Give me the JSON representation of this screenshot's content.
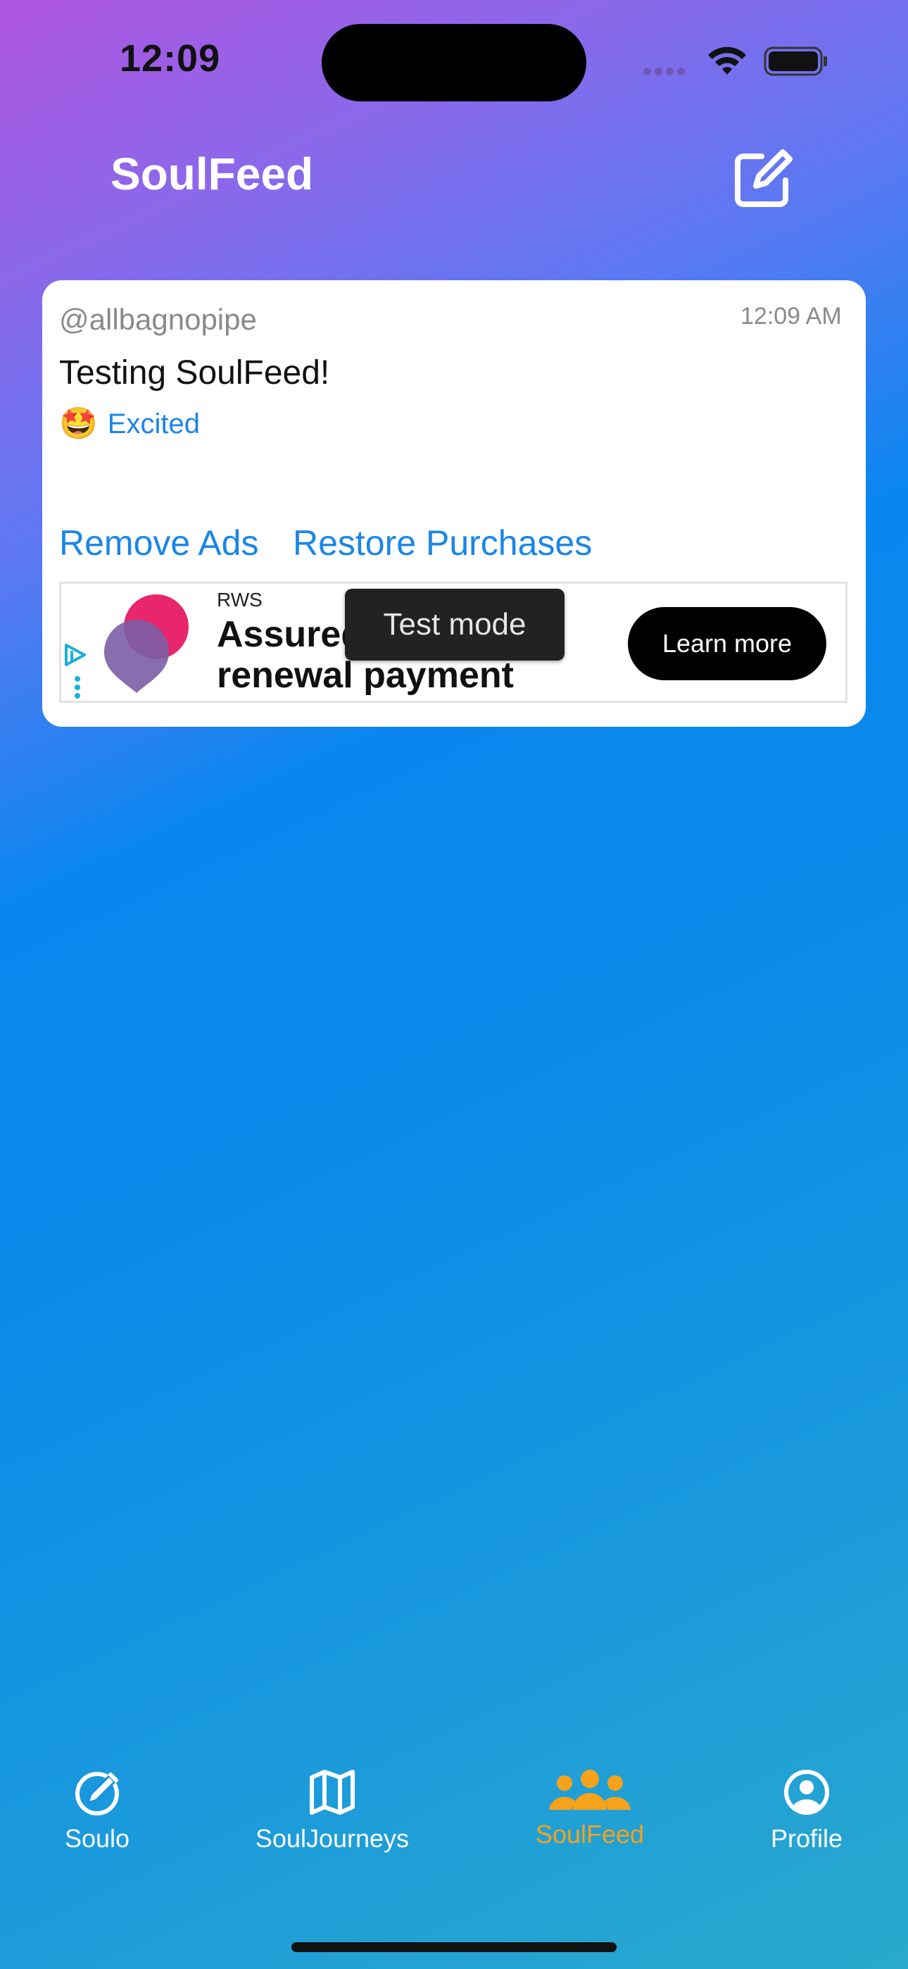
{
  "status_bar": {
    "time": "12:09"
  },
  "header": {
    "title": "SoulFeed",
    "compose_icon": "compose-icon"
  },
  "post": {
    "username": "@allbagnopipe",
    "time": "12:09 AM",
    "text": "Testing SoulFeed!",
    "mood_emoji": "🤩",
    "mood_label": "Excited"
  },
  "actions": {
    "remove_ads": "Remove Ads",
    "restore_purchases": "Restore Purchases"
  },
  "ad": {
    "advertiser": "RWS",
    "headline_line1": "Assured",
    "headline_line2": "renewal payment",
    "cta": "Learn more",
    "test_mode_label": "Test mode"
  },
  "tab_bar": {
    "items": [
      {
        "label": "Soulo",
        "icon": "compass-pen-icon"
      },
      {
        "label": "SoulJourneys",
        "icon": "map-icon"
      },
      {
        "label": "SoulFeed",
        "icon": "people-icon",
        "active": true
      },
      {
        "label": "Profile",
        "icon": "person-circle-icon"
      }
    ],
    "active_color": "#F6A21A"
  },
  "colors": {
    "link": "#1A86E8",
    "card_bg": "#FFFFFF"
  }
}
